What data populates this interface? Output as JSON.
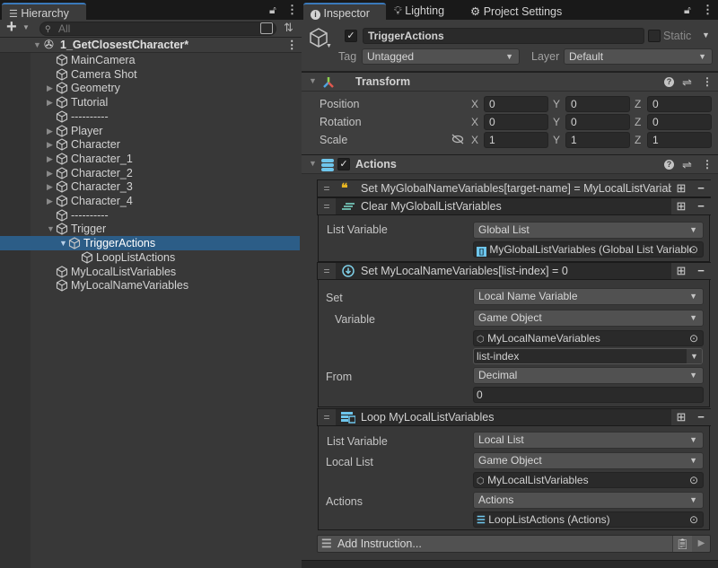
{
  "hierarchy": {
    "tab_label": "Hierarchy",
    "search_placeholder": "All",
    "add_button": "+",
    "scene": {
      "label": "1_GetClosestCharacter*",
      "expanded": true
    },
    "items": [
      {
        "label": "MainCamera",
        "depth": 1,
        "arrow": ""
      },
      {
        "label": "Camera Shot",
        "depth": 1,
        "arrow": ""
      },
      {
        "label": "Geometry",
        "depth": 1,
        "arrow": "collapsed"
      },
      {
        "label": "Tutorial",
        "depth": 1,
        "arrow": "collapsed"
      },
      {
        "label": "----------",
        "depth": 1,
        "arrow": ""
      },
      {
        "label": "Player",
        "depth": 1,
        "arrow": "collapsed"
      },
      {
        "label": "Character",
        "depth": 1,
        "arrow": "collapsed"
      },
      {
        "label": "Character_1",
        "depth": 1,
        "arrow": "collapsed"
      },
      {
        "label": "Character_2",
        "depth": 1,
        "arrow": "collapsed"
      },
      {
        "label": "Character_3",
        "depth": 1,
        "arrow": "collapsed"
      },
      {
        "label": "Character_4",
        "depth": 1,
        "arrow": "collapsed"
      },
      {
        "label": "----------",
        "depth": 1,
        "arrow": ""
      },
      {
        "label": "Trigger",
        "depth": 1,
        "arrow": "expanded"
      },
      {
        "label": "TriggerActions",
        "depth": 2,
        "arrow": "expanded",
        "selected": true
      },
      {
        "label": "LoopListActions",
        "depth": 3,
        "arrow": ""
      },
      {
        "label": "MyLocalListVariables",
        "depth": 1,
        "arrow": ""
      },
      {
        "label": "MyLocalNameVariables",
        "depth": 1,
        "arrow": ""
      }
    ]
  },
  "inspector": {
    "tabs": [
      {
        "label": "Inspector",
        "icon": "info-icon",
        "active": true
      },
      {
        "label": "Lighting",
        "icon": "lightbulb-icon",
        "active": false
      },
      {
        "label": "Project Settings",
        "icon": "gear-icon",
        "active": false
      }
    ],
    "object": {
      "active": true,
      "name": "TriggerActions",
      "static_label": "Static",
      "static": false,
      "tag_label": "Tag",
      "tag_value": "Untagged",
      "layer_label": "Layer",
      "layer_value": "Default"
    },
    "transform": {
      "title": "Transform",
      "rows": [
        {
          "label": "Position",
          "x": "0",
          "y": "0",
          "z": "0"
        },
        {
          "label": "Rotation",
          "x": "0",
          "y": "0",
          "z": "0"
        },
        {
          "label": "Scale",
          "x": "1",
          "y": "1",
          "z": "1"
        }
      ],
      "axis": {
        "x": "X",
        "y": "Y",
        "z": "Z"
      }
    },
    "actions": {
      "title": "Actions",
      "enabled": true,
      "instructions": [
        {
          "title": "Set MyGlobalNameVariables[target-name] = MyLocalListVariables"
        },
        {
          "title": "Clear MyGlobalListVariables",
          "fields": {
            "list_variable_label": "List Variable",
            "list_variable_value": "Global List",
            "object_value": "MyGlobalListVariables (Global List Variables)"
          }
        },
        {
          "title": "Set MyLocalNameVariables[list-index] = 0",
          "fields": {
            "set_label": "Set",
            "set_value": "Local Name Variable",
            "variable_label": "Variable",
            "variable_value": "Game Object",
            "object_value": "MyLocalNameVariables",
            "name_value": "list-index",
            "from_label": "From",
            "from_value": "Decimal",
            "number_value": "0"
          }
        },
        {
          "title": "Loop MyLocalListVariables",
          "fields": {
            "list_variable_label": "List Variable",
            "list_variable_value": "Local List",
            "local_list_label": "Local List",
            "local_list_value": "Game Object",
            "object_value": "MyLocalListVariables",
            "actions_label": "Actions",
            "actions_value": "Actions",
            "actions_object": "LoopListActions (Actions)"
          }
        }
      ],
      "add_instruction_label": "Add Instruction..."
    }
  }
}
